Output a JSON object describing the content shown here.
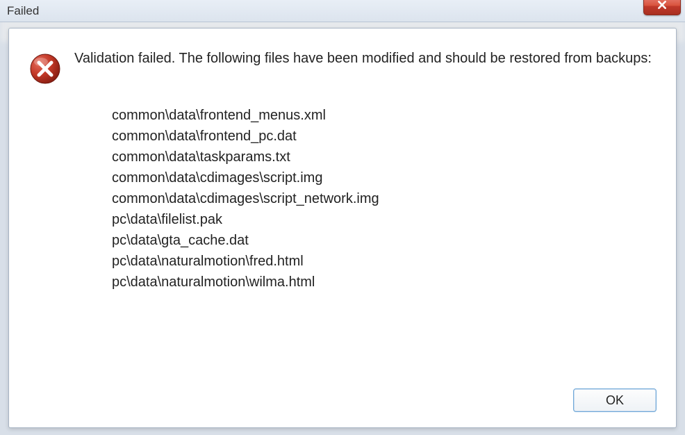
{
  "titlebar": {
    "title": "Failed"
  },
  "dialog": {
    "message": "Validation failed. The following files have been modified and should be restored from backups:",
    "files": [
      "common\\data\\frontend_menus.xml",
      "common\\data\\frontend_pc.dat",
      "common\\data\\taskparams.txt",
      "common\\data\\cdimages\\script.img",
      "common\\data\\cdimages\\script_network.img",
      "pc\\data\\filelist.pak",
      "pc\\data\\gta_cache.dat",
      "pc\\data\\naturalmotion\\fred.html",
      "pc\\data\\naturalmotion\\wilma.html"
    ],
    "ok_label": "OK"
  },
  "icons": {
    "error": "error-icon",
    "close": "close-icon"
  }
}
